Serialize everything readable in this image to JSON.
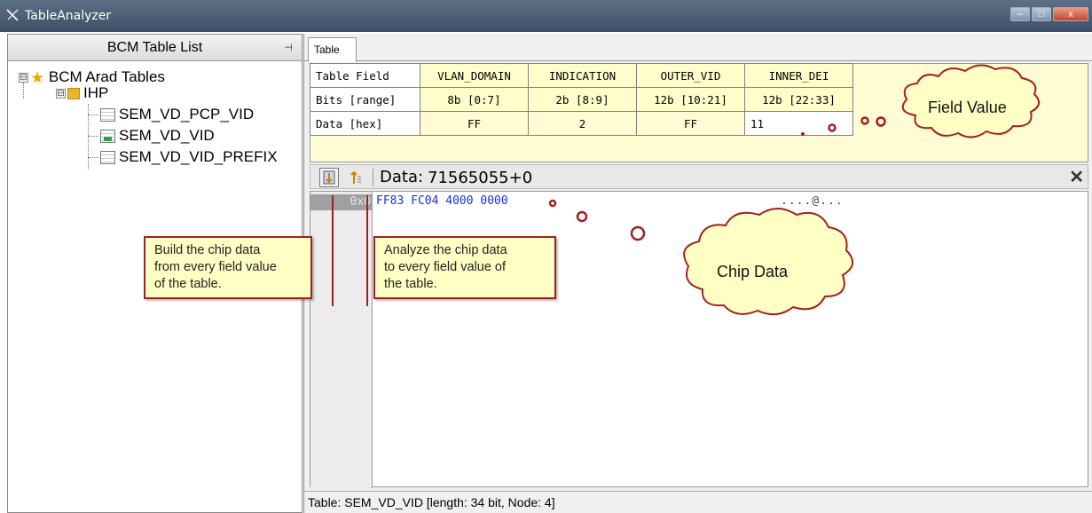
{
  "window": {
    "title": "TableAnalyzer",
    "minimize": "–",
    "maximize": "□",
    "close": "x"
  },
  "left_pane": {
    "header": "BCM Table List",
    "pin": "⊣",
    "tree": {
      "root": {
        "expander": "⊟",
        "label": "BCM Arad Tables"
      },
      "group": {
        "expander": "⊟",
        "label": "IHP"
      },
      "items": [
        {
          "label": "SEM_VD_PCP_VID"
        },
        {
          "label": "SEM_VD_VID"
        },
        {
          "label": "SEM_VD_VID_PREFIX"
        }
      ]
    }
  },
  "right_pane": {
    "tab": "Table",
    "field_grid": {
      "row_labels": [
        "Table Field",
        "Bits [range]",
        "Data [hex]"
      ],
      "fields": [
        "VLAN_DOMAIN",
        "INDICATION",
        "OUTER_VID",
        "INNER_DEI"
      ],
      "bits": [
        "8b [0:7]",
        "2b [8:9]",
        "12b [10:21]",
        "12b [22:33]"
      ],
      "data": [
        "FF",
        "2",
        "FF",
        "11"
      ]
    },
    "toolbar": {
      "data_label": "Data:",
      "data_value": "71565055+0",
      "close": "✕"
    },
    "hex": {
      "offset": "0x0",
      "bytes": "FF83 FC04 4000 0000",
      "ascii": "....@..."
    },
    "status": "Table: SEM_VD_VID [length: 34 bit,  Node: 4]"
  },
  "annotations": {
    "build": "Build  the chip data from  every field value of the table.",
    "build_lines": [
      "Build  the chip data",
      "from  every field value",
      "of the table."
    ],
    "analyze_lines": [
      "Analyze the chip data",
      "to every field value of",
      "the table."
    ],
    "cloud_field": "Field Value",
    "cloud_chip": "Chip Data",
    "accent": "#a02020",
    "cloud_fill": "#ffffc4"
  }
}
